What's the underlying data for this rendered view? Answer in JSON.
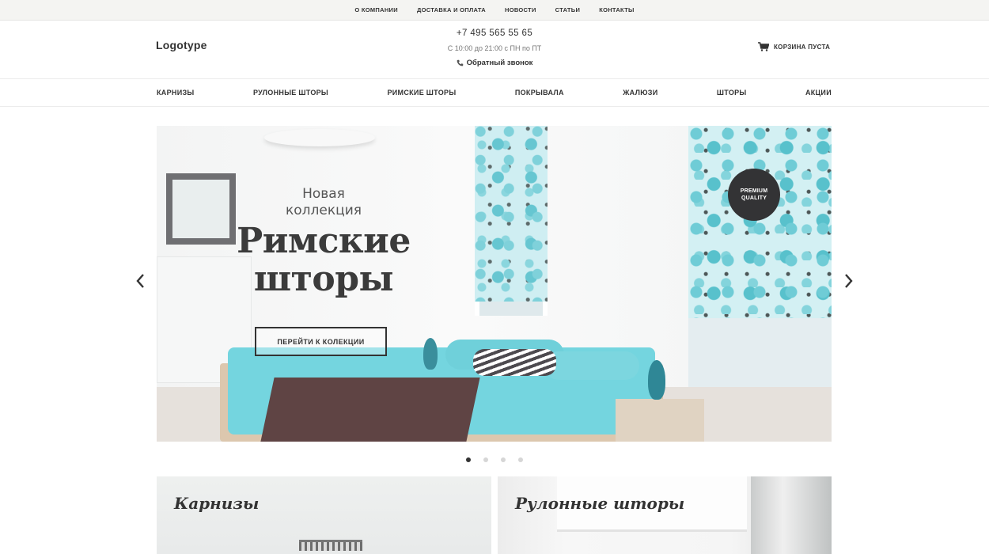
{
  "topbar": {
    "links": [
      "О КОМПАНИИ",
      "ДОСТАВКА И ОПЛАТА",
      "НОВОСТИ",
      "СТАТЬИ",
      "КОНТАКТЫ"
    ]
  },
  "header": {
    "logo": "Logotype",
    "phone": "+7 495 565 55 65",
    "hours": "С 10:00 до 21:00 с ПН по ПТ",
    "callback": "Обратный звонок",
    "cart_label": "КОРЗИНА ПУСТА"
  },
  "catnav": {
    "items": [
      "КАРНИЗЫ",
      "РУЛОННЫЕ ШТОРЫ",
      "РИМСКИЕ ШТОРЫ",
      "ПОКРЫВАЛА",
      "ЖАЛЮЗИ",
      "ШТОРЫ",
      "АКЦИИ"
    ]
  },
  "slider": {
    "kicker": "Новая коллекция",
    "title_line1": "Римские",
    "title_line2": "шторы",
    "cta": "ПЕРЕЙТИ К КОЛЕКЦИИ",
    "badge_line1": "PREMIUM",
    "badge_line2": "QUALITY",
    "slide_count": 4,
    "active_slide": 1
  },
  "tiles": [
    {
      "title": "Карнизы"
    },
    {
      "title": "Рулонные шторы"
    }
  ],
  "icons": {
    "cart": "cart-icon",
    "phone": "phone-icon",
    "prev": "chevron-left-icon",
    "next": "chevron-right-icon"
  },
  "colors": {
    "accent_turquoise": "#74d5df",
    "dark": "#333333"
  }
}
